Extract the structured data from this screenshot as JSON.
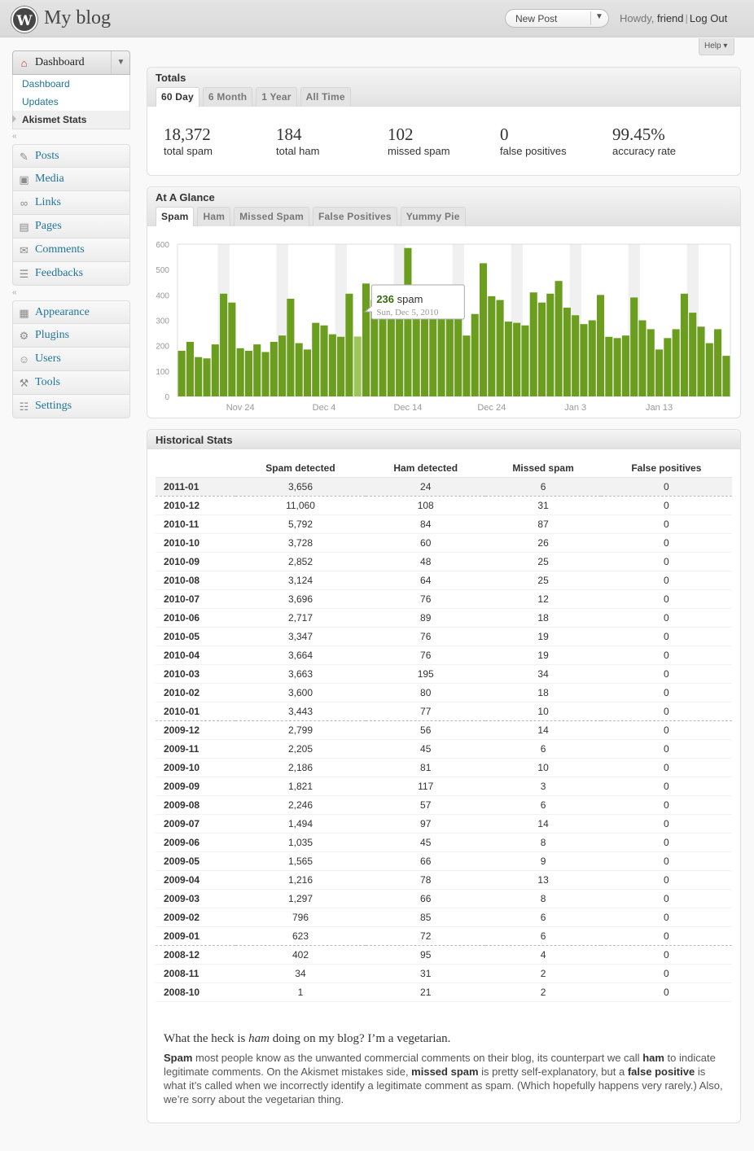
{
  "header": {
    "site_title": "My blog",
    "logo_letter": "W",
    "new_post": "New Post",
    "howdy_prefix": "Howdy, ",
    "user": "friend",
    "logout": "Log Out",
    "help": "Help ▾"
  },
  "menu": {
    "dashboard": "Dashboard",
    "dashboard_sub": [
      "Dashboard",
      "Updates",
      "Akismet Stats"
    ],
    "group1": [
      {
        "label": "Posts",
        "icon": "pin-icon"
      },
      {
        "label": "Media",
        "icon": "media-icon"
      },
      {
        "label": "Links",
        "icon": "link-icon"
      },
      {
        "label": "Pages",
        "icon": "pages-icon"
      },
      {
        "label": "Comments",
        "icon": "comments-icon"
      },
      {
        "label": "Feedbacks",
        "icon": "feedback-icon"
      }
    ],
    "group2": [
      {
        "label": "Appearance",
        "icon": "appearance-icon"
      },
      {
        "label": "Plugins",
        "icon": "plugin-icon"
      },
      {
        "label": "Users",
        "icon": "users-icon"
      },
      {
        "label": "Tools",
        "icon": "tools-icon"
      },
      {
        "label": "Settings",
        "icon": "settings-icon"
      }
    ]
  },
  "totals": {
    "title": "Totals",
    "tabs": [
      "60 Day",
      "6 Month",
      "1 Year",
      "All Time"
    ],
    "active_tab": "60 Day",
    "stats": [
      {
        "value": "18,372",
        "label": "total spam"
      },
      {
        "value": "184",
        "label": "total ham"
      },
      {
        "value": "102",
        "label": "missed spam"
      },
      {
        "value": "0",
        "label": "false positives"
      },
      {
        "value": "99.45%",
        "label": "accuracy rate"
      }
    ]
  },
  "glance": {
    "title": "At A Glance",
    "tabs": [
      "Spam",
      "Ham",
      "Missed Spam",
      "False Positives",
      "Yummy Pie"
    ],
    "active_tab": "Spam",
    "tooltip": {
      "count": "236",
      "unit": " spam",
      "date": "Sun, Dec 5, 2010"
    }
  },
  "chart_data": {
    "type": "bar",
    "ylim": [
      0,
      600
    ],
    "yticks": [
      "0",
      "100",
      "200",
      "300",
      "400",
      "500",
      "600"
    ],
    "xticks": [
      "Nov 24",
      "Dec 4",
      "Dec 14",
      "Dec 24",
      "Jan 3",
      "Jan 13"
    ],
    "values": [
      180,
      215,
      155,
      150,
      205,
      405,
      370,
      190,
      180,
      205,
      175,
      215,
      240,
      385,
      210,
      185,
      290,
      280,
      245,
      235,
      405,
      236,
      445,
      380,
      405,
      375,
      400,
      585,
      420,
      410,
      400,
      365,
      325,
      400,
      240,
      325,
      525,
      395,
      380,
      295,
      290,
      280,
      410,
      370,
      405,
      455,
      350,
      320,
      285,
      300,
      400,
      235,
      230,
      240,
      390,
      300,
      265,
      185,
      230,
      265,
      405,
      330,
      275,
      210,
      265,
      160
    ],
    "highlight_index": 21,
    "bar_color": "#6b9e1f",
    "highlight_color": "#9cc65a"
  },
  "history": {
    "title": "Historical Stats",
    "columns": [
      "",
      "Spam detected",
      "Ham detected",
      "Missed spam",
      "False positives"
    ],
    "rows": [
      [
        "2011-01",
        "3,656",
        "24",
        "6",
        "0"
      ],
      [
        "2010-12",
        "11,060",
        "108",
        "31",
        "0"
      ],
      [
        "2010-11",
        "5,792",
        "84",
        "87",
        "0"
      ],
      [
        "2010-10",
        "3,728",
        "60",
        "26",
        "0"
      ],
      [
        "2010-09",
        "2,852",
        "48",
        "25",
        "0"
      ],
      [
        "2010-08",
        "3,124",
        "64",
        "25",
        "0"
      ],
      [
        "2010-07",
        "3,696",
        "76",
        "12",
        "0"
      ],
      [
        "2010-06",
        "2,717",
        "89",
        "18",
        "0"
      ],
      [
        "2010-05",
        "3,347",
        "76",
        "19",
        "0"
      ],
      [
        "2010-04",
        "3,664",
        "76",
        "19",
        "0"
      ],
      [
        "2010-03",
        "3,663",
        "195",
        "34",
        "0"
      ],
      [
        "2010-02",
        "3,600",
        "80",
        "18",
        "0"
      ],
      [
        "2010-01",
        "3,443",
        "77",
        "10",
        "0"
      ],
      [
        "2009-12",
        "2,799",
        "56",
        "14",
        "0"
      ],
      [
        "2009-11",
        "2,205",
        "45",
        "6",
        "0"
      ],
      [
        "2009-10",
        "2,186",
        "81",
        "10",
        "0"
      ],
      [
        "2009-09",
        "1,821",
        "117",
        "3",
        "0"
      ],
      [
        "2009-08",
        "2,246",
        "57",
        "6",
        "0"
      ],
      [
        "2009-07",
        "1,494",
        "97",
        "14",
        "0"
      ],
      [
        "2009-06",
        "1,035",
        "45",
        "8",
        "0"
      ],
      [
        "2009-05",
        "1,565",
        "66",
        "9",
        "0"
      ],
      [
        "2009-04",
        "1,216",
        "78",
        "13",
        "0"
      ],
      [
        "2009-03",
        "1,297",
        "66",
        "8",
        "0"
      ],
      [
        "2009-02",
        "796",
        "85",
        "6",
        "0"
      ],
      [
        "2009-01",
        "623",
        "72",
        "6",
        "0"
      ],
      [
        "2008-12",
        "402",
        "95",
        "4",
        "0"
      ],
      [
        "2008-11",
        "34",
        "31",
        "2",
        "0"
      ],
      [
        "2008-10",
        "1",
        "21",
        "2",
        "0"
      ]
    ],
    "faq_question_before": "What the heck is ",
    "faq_question_em": "ham",
    "faq_question_after": " doing on my blog? I’m a vegetarian.",
    "faq_answer": [
      {
        "b": "Spam"
      },
      {
        "t": " most people know as the unwanted commercial comments on their blog, its counterpart we call "
      },
      {
        "b": "ham"
      },
      {
        "t": " to indicate legitimate comments. On the Akismet mistakes side, "
      },
      {
        "b": "missed spam"
      },
      {
        "t": " is pretty self-explanatory, but a "
      },
      {
        "b": "false positive"
      },
      {
        "t": " is what it’s called when we incorrectly identify a legitimate comment as spam. (Which hopefully happens very rarely.) Also, we’re sorry about the vegetarian thing."
      }
    ]
  }
}
